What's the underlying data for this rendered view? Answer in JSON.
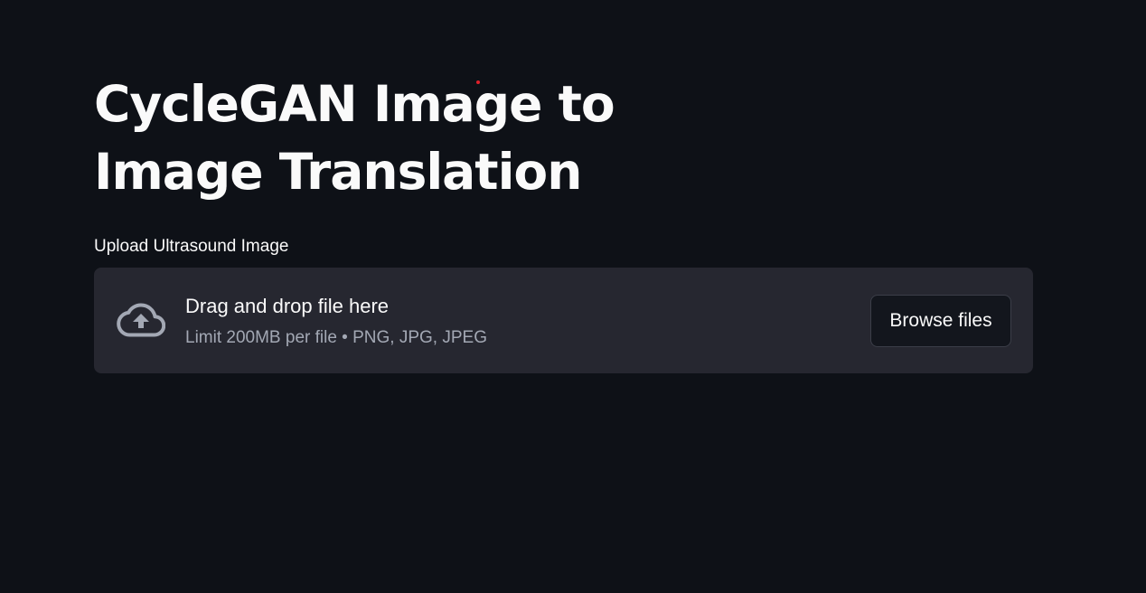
{
  "header": {
    "title": "CycleGAN Image to Image Translation"
  },
  "uploader": {
    "label": "Upload Ultrasound Image",
    "drop_title": "Drag and drop file here",
    "drop_limit": "Limit 200MB per file • PNG, JPG, JPEG",
    "browse_label": "Browse files",
    "icon": "cloud-upload-icon"
  },
  "colors": {
    "background": "#0e1117",
    "dropzone": "#262730",
    "text": "#fafafa",
    "muted_text": "#a3a8b4"
  }
}
